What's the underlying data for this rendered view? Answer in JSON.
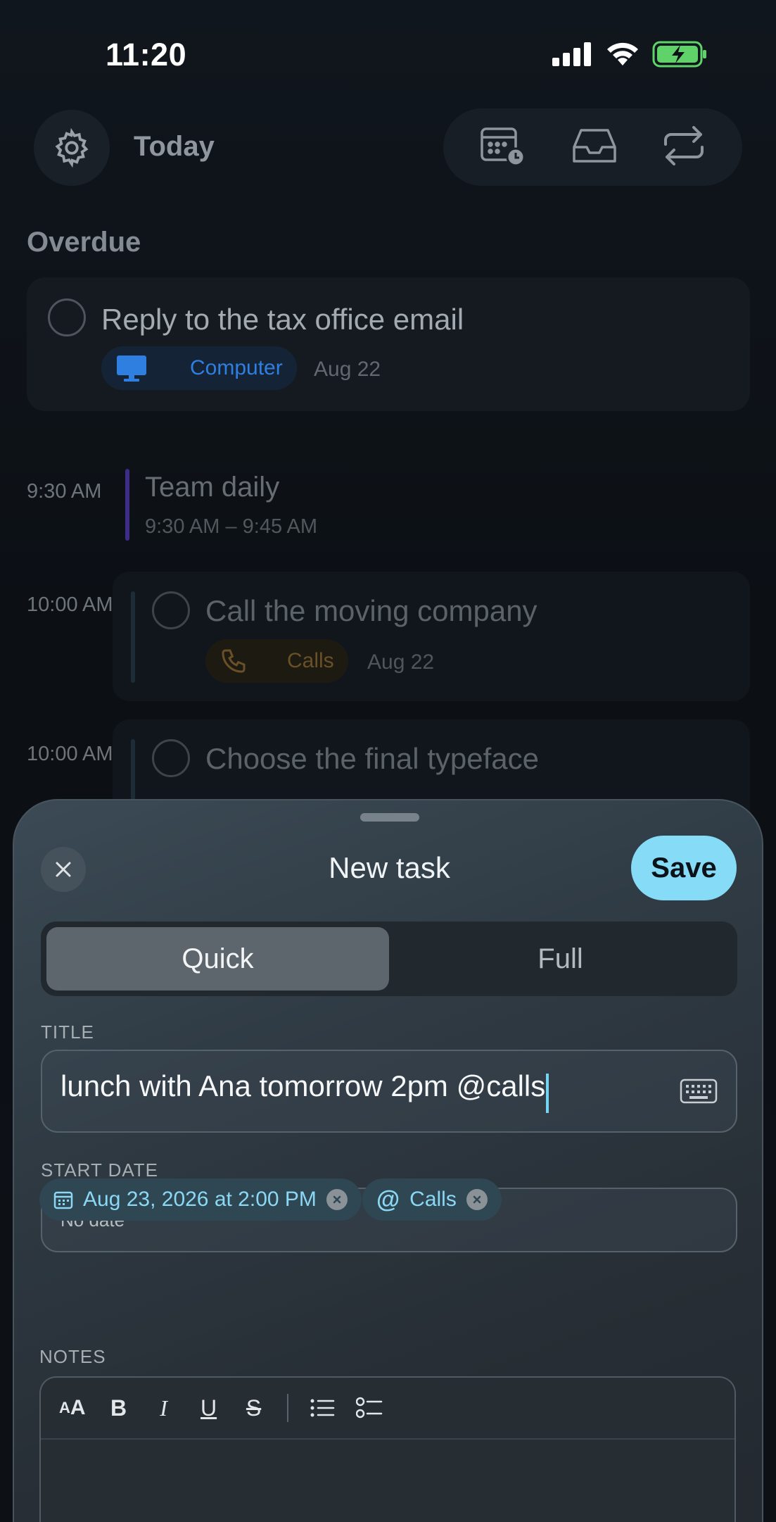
{
  "status_bar": {
    "time": "11:20"
  },
  "header": {
    "title": "Today"
  },
  "overdue": {
    "section_title": "Overdue",
    "task": {
      "title": "Reply to the tax office email",
      "tag": "Computer",
      "date": "Aug 22"
    }
  },
  "timeline": [
    {
      "time": "9:30 AM",
      "title": "Team daily",
      "subtitle": "9:30 AM – 9:45 AM"
    },
    {
      "time": "10:00 AM",
      "title": "Call the moving company",
      "tag": "Calls",
      "date": "Aug 22"
    },
    {
      "time": "10:00 AM",
      "title": "Choose the final typeface"
    }
  ],
  "sheet": {
    "title": "New task",
    "save_label": "Save",
    "tabs": [
      {
        "label": "Quick",
        "active": true
      },
      {
        "label": "Full",
        "active": false
      }
    ],
    "title_label": "TITLE",
    "title_value": "lunch with Ana tomorrow 2pm @calls",
    "start_date_label": "START DATE",
    "start_date_value": "No date",
    "chips": [
      {
        "label": "Aug 23, 2026 at 2:00 PM",
        "icon": "calendar-icon"
      },
      {
        "label": "Calls",
        "icon": "at-icon"
      }
    ],
    "notes_label": "NOTES",
    "toolbar": [
      "AA",
      "B",
      "I",
      "U",
      "S"
    ]
  },
  "colors": {
    "accent": "#86dcf7",
    "computer_tag": "#2f7fe0",
    "calls_tag": "#c98a2a",
    "event_bar": "#5a3fc0"
  }
}
